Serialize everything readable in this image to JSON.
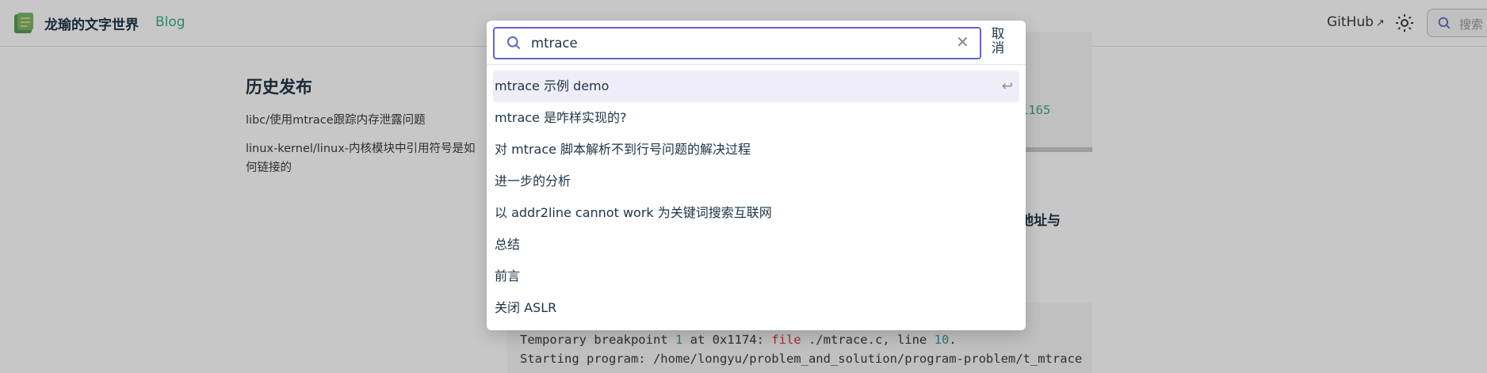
{
  "navbar": {
    "site_title": "龙瑜的文字世界",
    "blog_link": "Blog",
    "github_link": "GitHub",
    "search_placeholder": "搜索"
  },
  "sidebar": {
    "history_title": "历史发布",
    "links": [
      "libc/使用mtrace跟踪内存泄露问题",
      "linux-kernel/linux-内核模块中引用符号是如何链接的"
    ]
  },
  "content": {
    "code_top_number": "1165",
    "heading_fragment": "地址与",
    "code_bottom_lines": [
      {
        "parts": [
          {
            "t": "Temporary breakpoint ",
            "c": ""
          },
          {
            "t": "1",
            "c": "num"
          },
          {
            "t": " at 0x1174: ",
            "c": ""
          },
          {
            "t": "file",
            "c": "key"
          },
          {
            "t": " ./mtrace.c, line ",
            "c": ""
          },
          {
            "t": "10",
            "c": "num"
          },
          {
            "t": ".",
            "c": ""
          }
        ]
      },
      {
        "parts": [
          {
            "t": "Starting program: /home/longyu/problem_and_solution/program-problem/t_mtrace",
            "c": ""
          }
        ]
      }
    ]
  },
  "search_modal": {
    "query": "mtrace",
    "cancel_label": "取消",
    "results": [
      "mtrace 示例 demo",
      "mtrace 是咋样实现的?",
      "对 mtrace 脚本解析不到行号问题的解决过程",
      "进一步的分析",
      "以 addr2line cannot work 为关键词搜索互联网",
      "总结",
      "前言",
      "关闭 ASLR"
    ],
    "active_index": 0
  },
  "colors": {
    "accent": "#6366c9",
    "brand_green": "#3eaf7c",
    "active_row": "#efeef8"
  },
  "icons": [
    "logo-icon",
    "external-link-icon",
    "sun-icon",
    "search-icon",
    "close-icon",
    "enter-icon"
  ]
}
